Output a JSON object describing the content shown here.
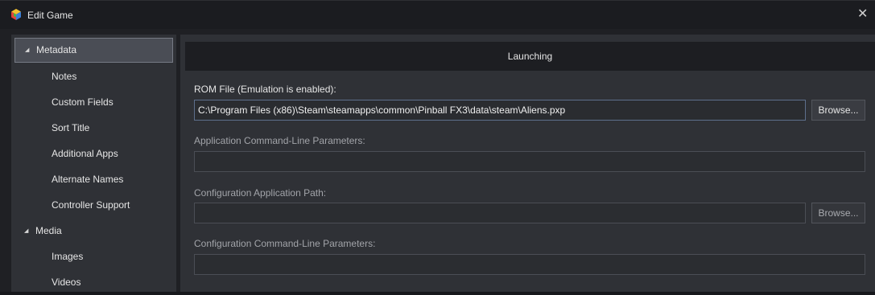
{
  "window": {
    "title": "Edit Game",
    "close_glyph": "✕",
    "app_icon": "launchbox-cube-icon"
  },
  "sidebar": {
    "items": [
      {
        "label": "Metadata",
        "level": 1,
        "expanded": true,
        "selected": true,
        "arrow": "◢"
      },
      {
        "label": "Notes",
        "level": 2
      },
      {
        "label": "Custom Fields",
        "level": 2
      },
      {
        "label": "Sort Title",
        "level": 2
      },
      {
        "label": "Additional Apps",
        "level": 2
      },
      {
        "label": "Alternate Names",
        "level": 2
      },
      {
        "label": "Controller Support",
        "level": 2
      },
      {
        "label": "Media",
        "level": 1,
        "expanded": true,
        "arrow": "◢"
      },
      {
        "label": "Images",
        "level": 2
      },
      {
        "label": "Videos",
        "level": 2
      }
    ]
  },
  "main": {
    "section_title": "Launching",
    "rom_file": {
      "label": "ROM File (Emulation is enabled):",
      "value": "C:\\Program Files (x86)\\Steam\\steamapps\\common\\Pinball FX3\\data\\steam\\Aliens.pxp",
      "browse_label": "Browse..."
    },
    "app_params": {
      "label": "Application Command-Line Parameters:",
      "value": ""
    },
    "config_app_path": {
      "label": "Configuration Application Path:",
      "value": "",
      "browse_label": "Browse..."
    },
    "config_params": {
      "label": "Configuration Command-Line Parameters:",
      "value": ""
    }
  },
  "colors": {
    "background": "#1f2024",
    "panel": "#2f3136",
    "header": "#1d1e22",
    "selected": "#4a4d55",
    "focus_border": "#5d6f8c"
  }
}
